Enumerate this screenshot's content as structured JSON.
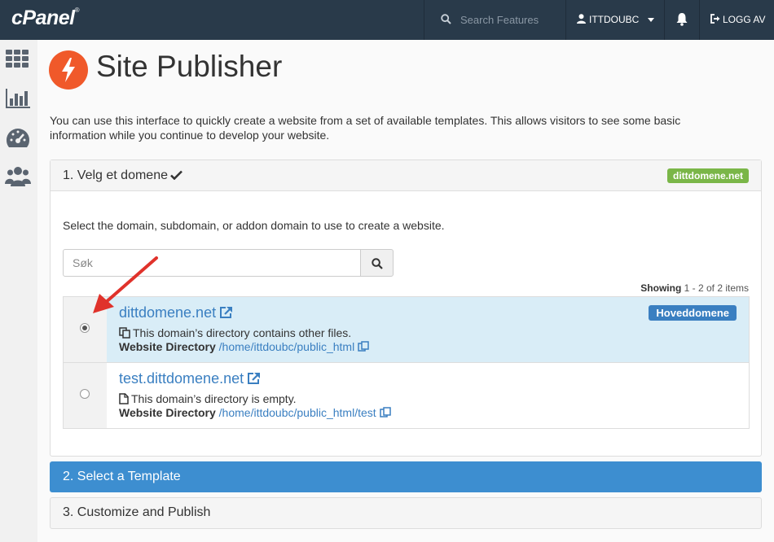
{
  "topbar": {
    "logo": "cPanel",
    "logo_mark": "®",
    "search_placeholder": "Search Features",
    "username": "ITTDOUBC",
    "logout_label": "LOGG AV"
  },
  "sidebar": {
    "items": [
      {
        "icon": "grid-icon"
      },
      {
        "icon": "bar-chart-icon"
      },
      {
        "icon": "dashboard-gauge-icon"
      },
      {
        "icon": "users-icon"
      }
    ]
  },
  "page": {
    "title": "Site Publisher",
    "intro": "You can use this interface to quickly create a website from a set of available templates. This allows visitors to see some basic information while you continue to develop your website."
  },
  "step1": {
    "title": "1. Velg et domene",
    "selected_badge": "dittdomene.net",
    "instruction": "Select the domain, subdomain, or addon domain to use to create a website.",
    "filter_placeholder": "Søk",
    "showing_label": "Showing",
    "showing_range": "1 - 2 of 2 items",
    "domains": [
      {
        "name": "dittdomene.net",
        "selected": true,
        "badge": "Hoveddomene",
        "description": "This domain’s directory contains other files.",
        "dir_label": "Website Directory",
        "dir_path": "/home/ittdoubc/public_html"
      },
      {
        "name": "test.dittdomene.net",
        "selected": false,
        "description": "This domain’s directory is empty.",
        "dir_label": "Website Directory",
        "dir_path": "/home/ittdoubc/public_html/test"
      }
    ]
  },
  "step2": {
    "title": "2. Select a Template"
  },
  "step3": {
    "title": "3. Customize and Publish"
  },
  "colors": {
    "topbar": "#293a4a",
    "accent_blue": "#3d8ed0",
    "link_blue": "#3a7fc1",
    "badge_green": "#7ab648",
    "selected_row": "#d9edf7",
    "icon_orange": "#f0592a",
    "arrow_red": "#e0322b"
  }
}
